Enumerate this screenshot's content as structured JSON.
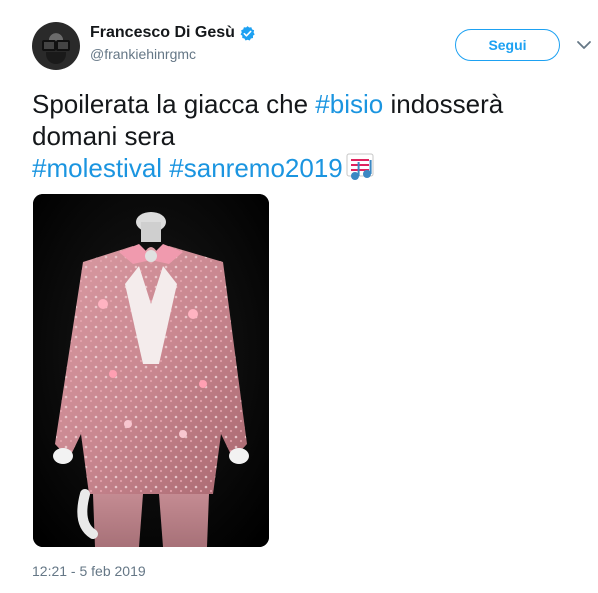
{
  "author": {
    "display_name": "Francesco Di Gesù",
    "handle": "@frankiehinrgmc",
    "verified": true,
    "avatar_icon": "person-avatar"
  },
  "actions": {
    "follow_label": "Segui",
    "menu_icon": "chevron-down-icon"
  },
  "tweet": {
    "text_part1": "Spoilerata la giacca che ",
    "hashtag_bisio": "#bisio",
    "text_part2": " indosserà domani sera",
    "hashtag_molestival": "#molestival",
    "hashtag_sanremo": "#sanremo2019",
    "emoji_icon": "musical-score-icon",
    "timestamp": "12:21 - 5 feb 2019"
  },
  "media": {
    "description_icon": "photo-jacket"
  },
  "colors": {
    "link": "#1b95e0",
    "follow": "#1da1f2",
    "muted": "#657786",
    "text": "#14171a"
  }
}
